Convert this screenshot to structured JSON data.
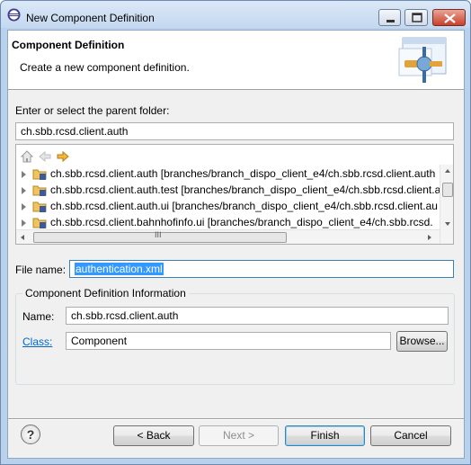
{
  "window": {
    "title": "New Component Definition",
    "accent_color": "#b9d1ea"
  },
  "banner": {
    "title": "Component Definition",
    "description": "Create a new component definition."
  },
  "parent_folder": {
    "label": "Enter or select the parent folder:",
    "value": "ch.sbb.rcsd.client.auth"
  },
  "tree": {
    "toolbar_icons": [
      "home-icon",
      "back-arrow-icon",
      "forward-arrow-icon"
    ],
    "items": [
      {
        "label": "ch.sbb.rcsd.client.auth [branches/branch_dispo_client_e4/ch.sbb.rcsd.client.auth"
      },
      {
        "label": "ch.sbb.rcsd.client.auth.test [branches/branch_dispo_client_e4/ch.sbb.rcsd.client.a"
      },
      {
        "label": "ch.sbb.rcsd.client.auth.ui [branches/branch_dispo_client_e4/ch.sbb.rcsd.client.au"
      },
      {
        "label": "ch.sbb.rcsd.client.bahnhofinfo.ui [branches/branch_dispo_client_e4/ch.sbb.rcsd."
      }
    ],
    "hscroll_grip": "III"
  },
  "file_name": {
    "label": "File name:",
    "value": "authentication.xml"
  },
  "component_info": {
    "group_title": "Component Definition Information",
    "name_label": "Name:",
    "name_value": "ch.sbb.rcsd.client.auth",
    "class_label": "Class:",
    "class_value": "Component",
    "browse_label": "Browse..."
  },
  "buttons": {
    "help": "?",
    "back": "< Back",
    "next": "Next >",
    "finish": "Finish",
    "cancel": "Cancel"
  }
}
